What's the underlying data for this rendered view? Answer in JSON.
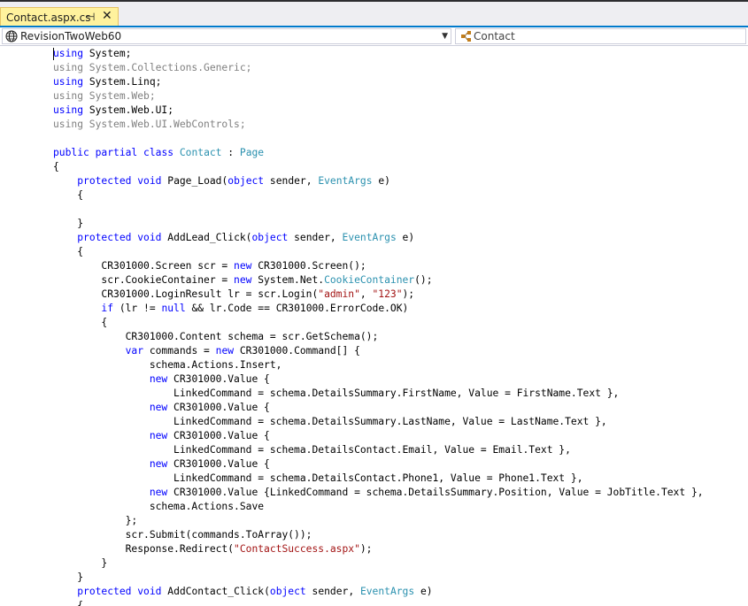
{
  "tab": {
    "title": "Contact.aspx.cs",
    "pin_glyph": "⊣",
    "close_glyph": "✕"
  },
  "navbar": {
    "project": "RevisionTwoWeb60",
    "member": "Contact",
    "dropdown_glyph": "▼"
  },
  "colors": {
    "keyword": "#0000ff",
    "type": "#2b91af",
    "string": "#a31515",
    "faded": "#808080",
    "tab_active": "#fff29d",
    "accent": "#007acc"
  },
  "code_lines": [
    [
      [
        "k",
        "using"
      ],
      [
        "p",
        " System;"
      ]
    ],
    [
      [
        "f",
        "using System.Collections.Generic;"
      ]
    ],
    [
      [
        "k",
        "using"
      ],
      [
        "p",
        " System.Linq;"
      ]
    ],
    [
      [
        "f",
        "using System.Web;"
      ]
    ],
    [
      [
        "k",
        "using"
      ],
      [
        "p",
        " System.Web.UI;"
      ]
    ],
    [
      [
        "f",
        "using System.Web.UI.WebControls;"
      ]
    ],
    [],
    [
      [
        "k",
        "public"
      ],
      [
        "p",
        " "
      ],
      [
        "k",
        "partial"
      ],
      [
        "p",
        " "
      ],
      [
        "k",
        "class"
      ],
      [
        "p",
        " "
      ],
      [
        "t",
        "Contact"
      ],
      [
        "p",
        " : "
      ],
      [
        "t",
        "Page"
      ]
    ],
    [
      [
        "p",
        "{"
      ]
    ],
    [
      [
        "p",
        "    "
      ],
      [
        "k",
        "protected"
      ],
      [
        "p",
        " "
      ],
      [
        "k",
        "void"
      ],
      [
        "p",
        " Page_Load("
      ],
      [
        "k",
        "object"
      ],
      [
        "p",
        " sender, "
      ],
      [
        "t",
        "EventArgs"
      ],
      [
        "p",
        " e)"
      ]
    ],
    [
      [
        "p",
        "    {"
      ]
    ],
    [],
    [
      [
        "p",
        "    }"
      ]
    ],
    [
      [
        "p",
        "    "
      ],
      [
        "k",
        "protected"
      ],
      [
        "p",
        " "
      ],
      [
        "k",
        "void"
      ],
      [
        "p",
        " AddLead_Click("
      ],
      [
        "k",
        "object"
      ],
      [
        "p",
        " sender, "
      ],
      [
        "t",
        "EventArgs"
      ],
      [
        "p",
        " e)"
      ]
    ],
    [
      [
        "p",
        "    {"
      ]
    ],
    [
      [
        "p",
        "        CR301000.Screen scr = "
      ],
      [
        "k",
        "new"
      ],
      [
        "p",
        " CR301000.Screen();"
      ]
    ],
    [
      [
        "p",
        "        scr.CookieContainer = "
      ],
      [
        "k",
        "new"
      ],
      [
        "p",
        " System.Net."
      ],
      [
        "t",
        "CookieContainer"
      ],
      [
        "p",
        "();"
      ]
    ],
    [
      [
        "p",
        "        CR301000.LoginResult lr = scr.Login("
      ],
      [
        "s",
        "\"admin\""
      ],
      [
        "p",
        ", "
      ],
      [
        "s",
        "\"123\""
      ],
      [
        "p",
        ");"
      ]
    ],
    [
      [
        "p",
        "        "
      ],
      [
        "k",
        "if"
      ],
      [
        "p",
        " (lr != "
      ],
      [
        "k",
        "null"
      ],
      [
        "p",
        " && lr.Code == CR301000.ErrorCode.OK)"
      ]
    ],
    [
      [
        "p",
        "        {"
      ]
    ],
    [
      [
        "p",
        "            CR301000.Content schema = scr.GetSchema();"
      ]
    ],
    [
      [
        "p",
        "            "
      ],
      [
        "k",
        "var"
      ],
      [
        "p",
        " commands = "
      ],
      [
        "k",
        "new"
      ],
      [
        "p",
        " CR301000.Command[] {"
      ]
    ],
    [
      [
        "p",
        "                schema.Actions.Insert,"
      ]
    ],
    [
      [
        "p",
        "                "
      ],
      [
        "k",
        "new"
      ],
      [
        "p",
        " CR301000.Value {"
      ]
    ],
    [
      [
        "p",
        "                    LinkedCommand = schema.DetailsSummary.FirstName, Value = FirstName.Text },"
      ]
    ],
    [
      [
        "p",
        "                "
      ],
      [
        "k",
        "new"
      ],
      [
        "p",
        " CR301000.Value {"
      ]
    ],
    [
      [
        "p",
        "                    LinkedCommand = schema.DetailsSummary.LastName, Value = LastName.Text },"
      ]
    ],
    [
      [
        "p",
        "                "
      ],
      [
        "k",
        "new"
      ],
      [
        "p",
        " CR301000.Value {"
      ]
    ],
    [
      [
        "p",
        "                    LinkedCommand = schema.DetailsContact.Email, Value = Email.Text },"
      ]
    ],
    [
      [
        "p",
        "                "
      ],
      [
        "k",
        "new"
      ],
      [
        "p",
        " CR301000.Value {"
      ]
    ],
    [
      [
        "p",
        "                    LinkedCommand = schema.DetailsContact.Phone1, Value = Phone1.Text },"
      ]
    ],
    [
      [
        "p",
        "                "
      ],
      [
        "k",
        "new"
      ],
      [
        "p",
        " CR301000.Value {LinkedCommand = schema.DetailsSummary.Position, Value = JobTitle.Text },"
      ]
    ],
    [
      [
        "p",
        "                schema.Actions.Save"
      ]
    ],
    [
      [
        "p",
        "            };"
      ]
    ],
    [
      [
        "p",
        "            scr.Submit(commands.ToArray());"
      ]
    ],
    [
      [
        "p",
        "            Response.Redirect("
      ],
      [
        "s",
        "\"ContactSuccess.aspx\""
      ],
      [
        "p",
        ");"
      ]
    ],
    [
      [
        "p",
        "        }"
      ]
    ],
    [
      [
        "p",
        "    }"
      ]
    ],
    [
      [
        "p",
        "    "
      ],
      [
        "k",
        "protected"
      ],
      [
        "p",
        " "
      ],
      [
        "k",
        "void"
      ],
      [
        "p",
        " AddContact_Click("
      ],
      [
        "k",
        "object"
      ],
      [
        "p",
        " sender, "
      ],
      [
        "t",
        "EventArgs"
      ],
      [
        "p",
        " e)"
      ]
    ],
    [
      [
        "p",
        "    {"
      ]
    ]
  ]
}
